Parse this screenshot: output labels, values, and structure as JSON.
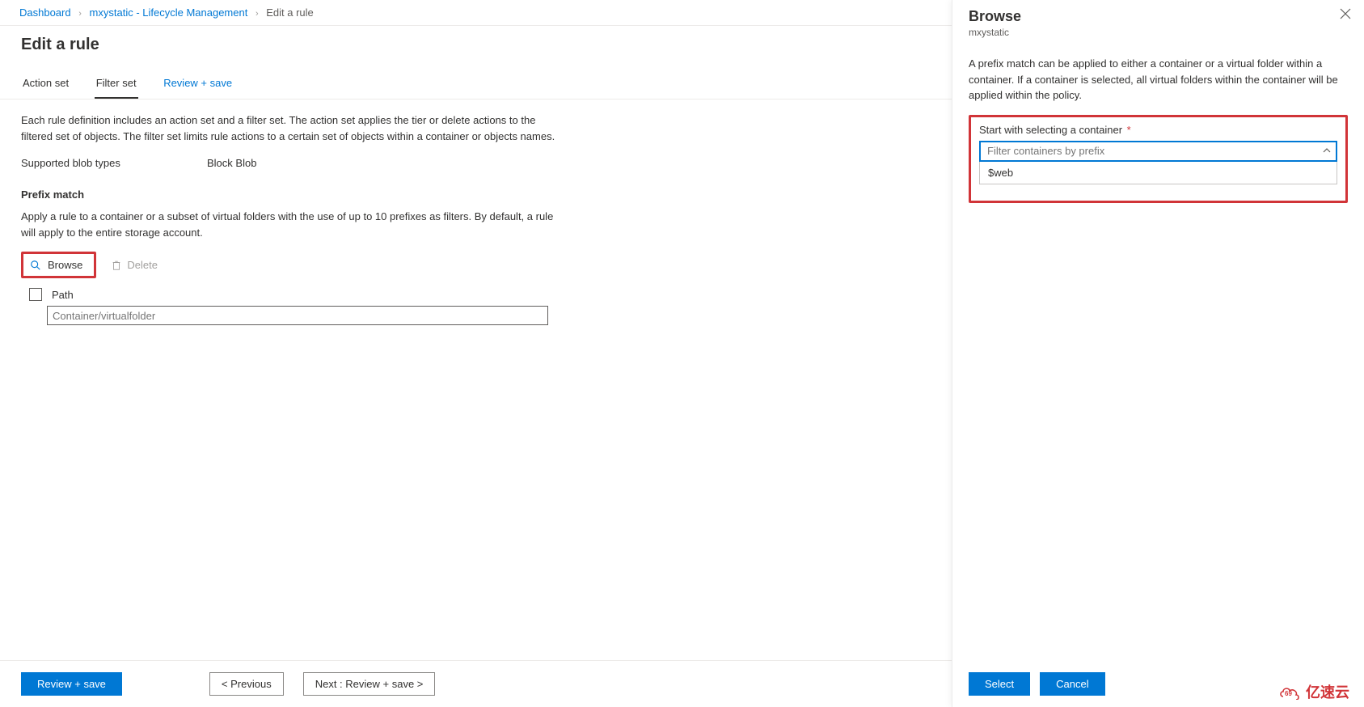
{
  "breadcrumb": {
    "items": [
      {
        "label": "Dashboard",
        "link": true
      },
      {
        "label": "mxystatic - Lifecycle Management",
        "link": true
      },
      {
        "label": "Edit a rule",
        "link": false
      }
    ]
  },
  "page": {
    "title": "Edit a rule"
  },
  "tabs": {
    "0": {
      "label": "Action set"
    },
    "1": {
      "label": "Filter set"
    },
    "2": {
      "label": "Review + save"
    }
  },
  "filterset": {
    "description": "Each rule definition includes an action set and a filter set. The action set applies the tier or delete actions to the filtered set of objects. The filter set limits rule actions to a certain set of objects within a container or objects names.",
    "blob_types_label": "Supported blob types",
    "blob_types_value": "Block Blob",
    "prefix_title": "Prefix match",
    "prefix_desc": "Apply a rule to a container or a subset of virtual folders with the use of up to 10 prefixes as filters. By default, a rule will apply to the entire storage account.",
    "browse_label": "Browse",
    "delete_label": "Delete",
    "path_label": "Path",
    "path_placeholder": "Container/virtualfolder"
  },
  "footer": {
    "review_save": "Review + save",
    "previous": "< Previous",
    "next": "Next : Review + save >"
  },
  "panel": {
    "title": "Browse",
    "subtitle": "mxystatic",
    "description": "A prefix match can be applied to either a container or a virtual folder within a container. If a container is selected, all virtual folders within the container will be applied within the policy.",
    "container_label": "Start with selecting a container",
    "container_required": "*",
    "container_placeholder": "Filter containers by prefix",
    "options": {
      "0": "$web"
    },
    "select": "Select",
    "cancel": "Cancel"
  },
  "watermark": {
    "text": "亿速云"
  }
}
